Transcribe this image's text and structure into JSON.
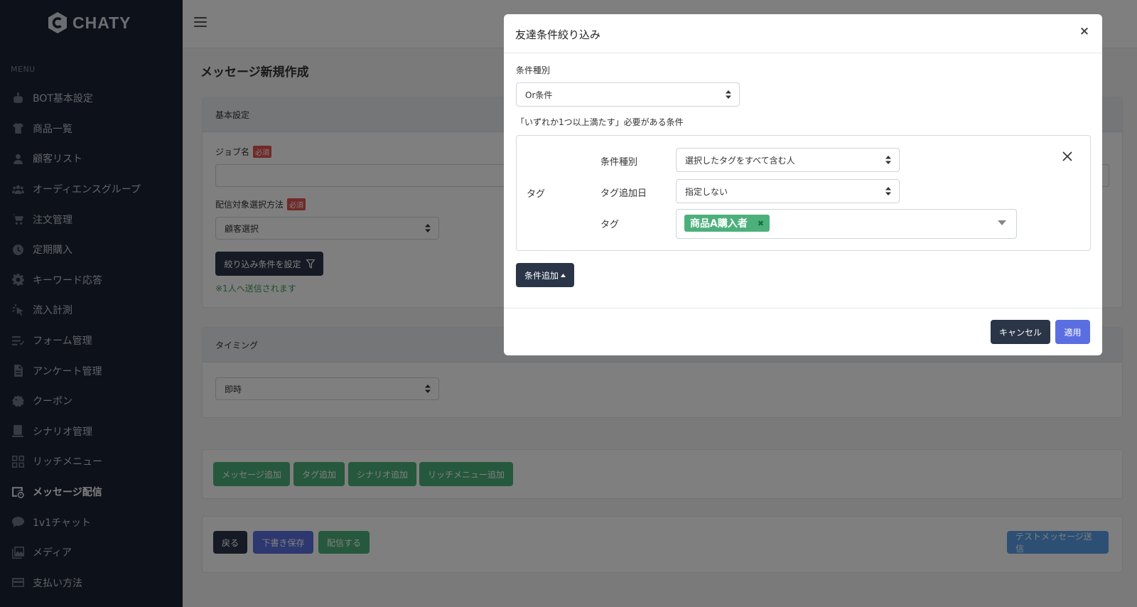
{
  "sidebar": {
    "logo_text": "CHATY",
    "menu_heading": "MENU",
    "items": [
      {
        "label": "BOT基本設定",
        "icon": "robot-icon"
      },
      {
        "label": "商品一覧",
        "icon": "tshirt-icon"
      },
      {
        "label": "顧客リスト",
        "icon": "user-icon"
      },
      {
        "label": "オーディエンスグループ",
        "icon": "users-icon"
      },
      {
        "label": "注文管理",
        "icon": "cart-icon"
      },
      {
        "label": "定期購入",
        "icon": "clock-icon"
      },
      {
        "label": "キーワード応答",
        "icon": "gear-icon"
      },
      {
        "label": "流入計測",
        "icon": "cursor-icon"
      },
      {
        "label": "フォーム管理",
        "icon": "list-icon"
      },
      {
        "label": "アンケート管理",
        "icon": "file-icon"
      },
      {
        "label": "クーポン",
        "icon": "ticket-icon"
      },
      {
        "label": "シナリオ管理",
        "icon": "scenario-icon"
      },
      {
        "label": "リッチメニュー",
        "icon": "grid-icon"
      },
      {
        "label": "メッセージ配信",
        "icon": "message-send-icon",
        "active": true
      },
      {
        "label": "1v1チャット",
        "icon": "chat-icon"
      },
      {
        "label": "メディア",
        "icon": "media-icon"
      },
      {
        "label": "支払い方法",
        "icon": "credit-card-icon"
      }
    ]
  },
  "page": {
    "title": "メッセージ新規作成",
    "basic_settings": {
      "header": "基本設定",
      "job_name_label": "ジョブ名",
      "required_badge": "必須",
      "job_name_value": "",
      "target_method_label": "配信対象選択方法",
      "target_method_value": "顧客選択",
      "filter_button": "絞り込み条件を設定",
      "recipients_note": "※1人へ送信されます"
    },
    "timing": {
      "header": "タイミング",
      "value": "即時"
    },
    "add_buttons": [
      "メッセージ追加",
      "タグ追加",
      "シナリオ追加",
      "リッチメニュー追加"
    ],
    "footer": {
      "back": "戻る",
      "save_draft": "下書き保存",
      "send": "配信する",
      "test_send": "テストメッセージ送信"
    }
  },
  "modal": {
    "title": "友達条件絞り込み",
    "condition_type_label": "条件種別",
    "condition_type_value": "Or条件",
    "description": "「いずれか1つ以上満たす」必要がある条件",
    "condition": {
      "category": "タグ",
      "type_label": "条件種別",
      "type_value": "選択したタグをすべて含む人",
      "date_label": "タグ追加日",
      "date_value": "指定しない",
      "tag_label": "タグ",
      "tags": [
        "商品A購入者"
      ]
    },
    "add_condition_button": "条件追加",
    "cancel_button": "キャンセル",
    "apply_button": "適用"
  },
  "colors": {
    "sidebar_bg": "#1a2233",
    "accent_dark": "#2a3548",
    "green": "#4cb07a",
    "indigo": "#5b6ee1",
    "required_red": "#e55353"
  }
}
